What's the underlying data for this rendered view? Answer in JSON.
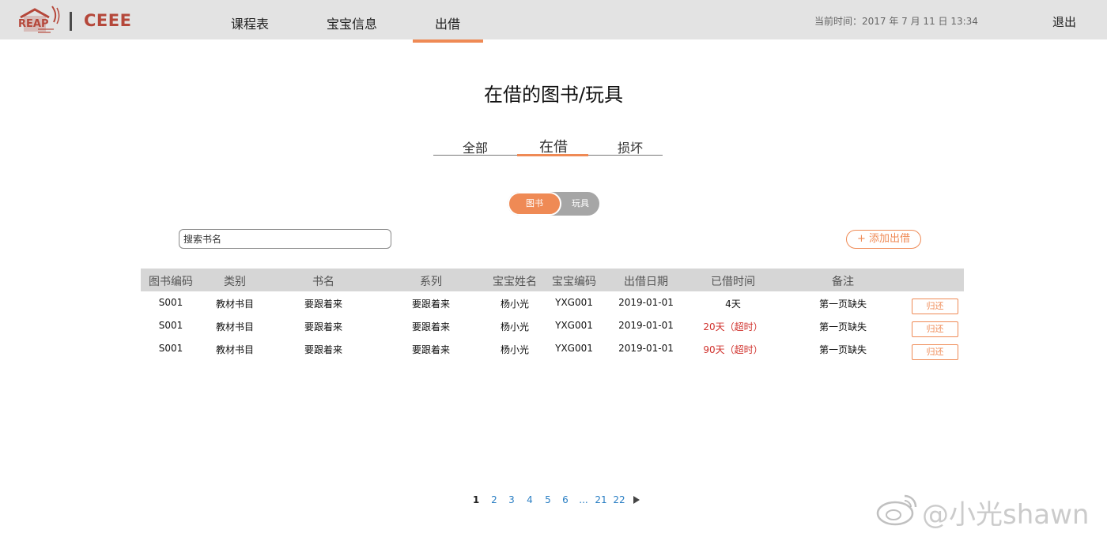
{
  "header": {
    "logo_text": "REAP",
    "brand": "CEEE",
    "nav": [
      {
        "label": "课程表"
      },
      {
        "label": "宝宝信息"
      },
      {
        "label": "出借"
      }
    ],
    "active_nav": "出借",
    "clock": "当前时间：2017 年 7 月 11 日 13:34",
    "logout": "退出"
  },
  "page": {
    "title": "在借的图书/玩具"
  },
  "status_tabs": [
    {
      "label": "全部"
    },
    {
      "label": "在借"
    },
    {
      "label": "损坏"
    }
  ],
  "active_tab": "在借",
  "toggle": {
    "on_label": "图书",
    "off_label": "玩具",
    "selected": "图书"
  },
  "search": {
    "placeholder": "搜索书名"
  },
  "add_button": "+ 添加出借",
  "table": {
    "columns": [
      "图书编码",
      "类别",
      "书名",
      "系列",
      "宝宝姓名",
      "宝宝编码",
      "出借日期",
      "已借时间",
      "备注"
    ],
    "rows": [
      {
        "code": "S001",
        "category": "教材书目",
        "title": "要跟着来",
        "series": "要跟着来",
        "baby_name": "杨小光",
        "baby_code": "YXG001",
        "date": "2019-01-01",
        "duration": "4天",
        "overdue": false,
        "note": "第一页缺失",
        "action": "归还"
      },
      {
        "code": "S001",
        "category": "教材书目",
        "title": "要跟着来",
        "series": "要跟着来",
        "baby_name": "杨小光",
        "baby_code": "YXG001",
        "date": "2019-01-01",
        "duration": "20天（超时）",
        "overdue": true,
        "note": "第一页缺失",
        "action": "归还"
      },
      {
        "code": "S001",
        "category": "教材书目",
        "title": "要跟着来",
        "series": "要跟着来",
        "baby_name": "杨小光",
        "baby_code": "YXG001",
        "date": "2019-01-01",
        "duration": "90天（超时）",
        "overdue": true,
        "note": "第一页缺失",
        "action": "归还"
      }
    ]
  },
  "pagination": {
    "pages": [
      "1",
      "2",
      "3",
      "4",
      "5",
      "6",
      "...",
      "21",
      "22"
    ],
    "current": "1"
  },
  "watermark": "@小光shawn",
  "colors": {
    "accent": "#ef8a55",
    "brand": "#b5473a",
    "overdue": "#d0302b",
    "link": "#2b7fc4",
    "header_bg": "#e3e3e3"
  },
  "icons": [
    "reap-logo-icon",
    "next-page-icon",
    "weibo-icon"
  ]
}
